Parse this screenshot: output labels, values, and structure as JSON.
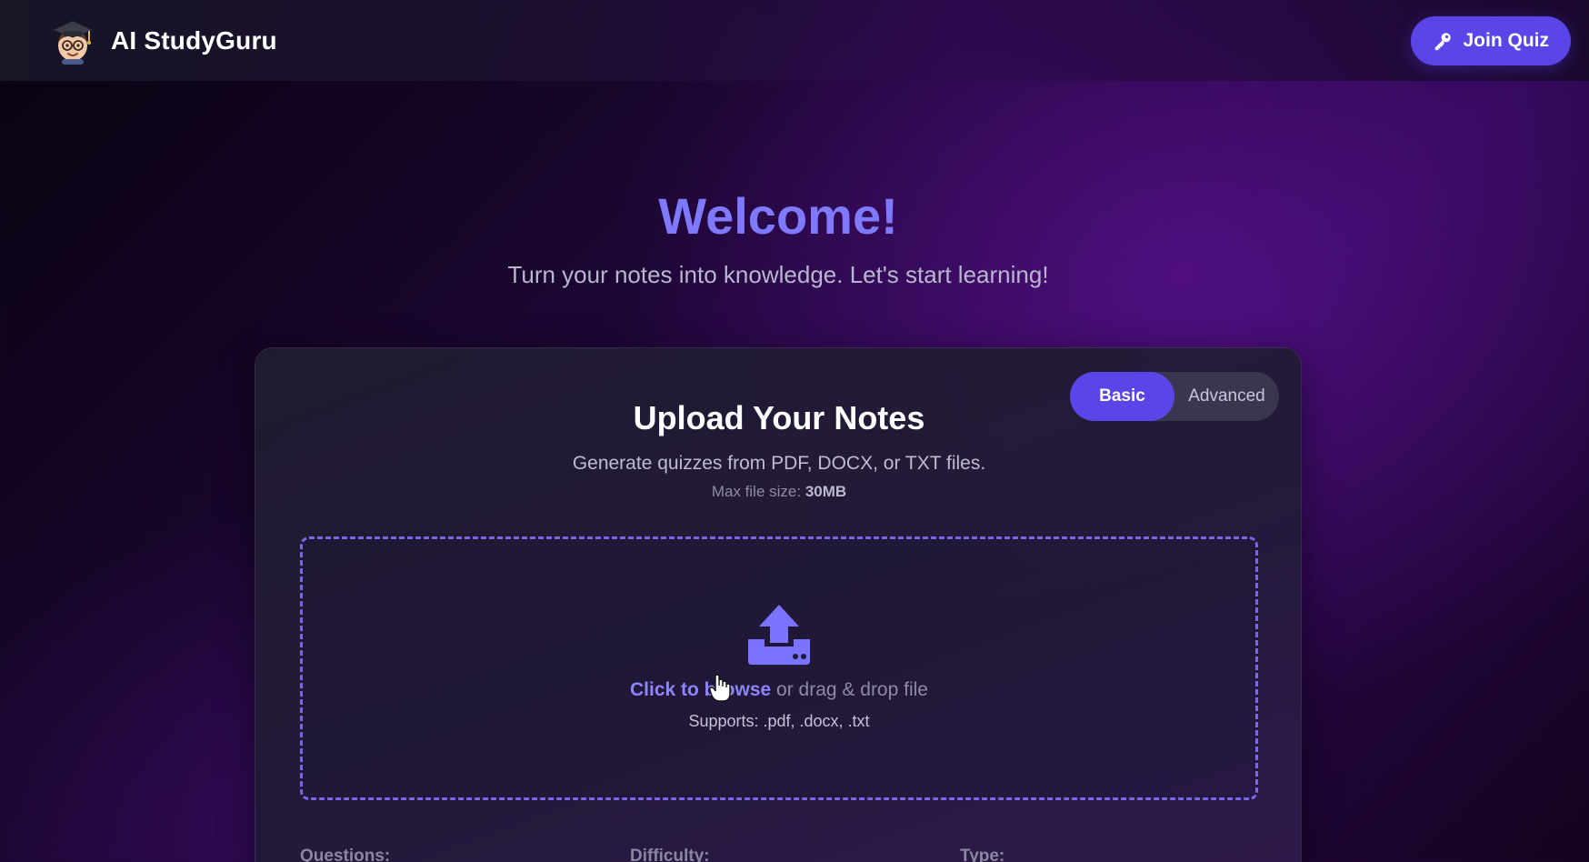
{
  "header": {
    "brand_name": "AI StudyGuru",
    "logo_icon": "student-mascot-logo",
    "join_button_label": "Join Quiz",
    "join_icon": "key-icon"
  },
  "hero": {
    "title": "Welcome!",
    "subtitle": "Turn your notes into knowledge. Let's start learning!"
  },
  "upload_card": {
    "title": "Upload Your Notes",
    "description": "Generate quizzes from PDF, DOCX, or TXT files.",
    "max_size_label": "Max file size:",
    "max_size_value": "30MB",
    "mode_toggle": {
      "options": [
        "Basic",
        "Advanced"
      ],
      "selected": "Basic"
    },
    "dropzone": {
      "icon": "upload-icon",
      "browse_link": "Click to browse",
      "drag_text": "or drag & drop file",
      "supports": "Supports: .pdf, .docx, .txt"
    },
    "settings_labels": [
      "Questions:",
      "Difficulty:",
      "Type:"
    ]
  },
  "colors": {
    "accent": "#5a45e8",
    "heading_accent": "#7f79ff",
    "dropzone_border": "#7a66e6"
  }
}
